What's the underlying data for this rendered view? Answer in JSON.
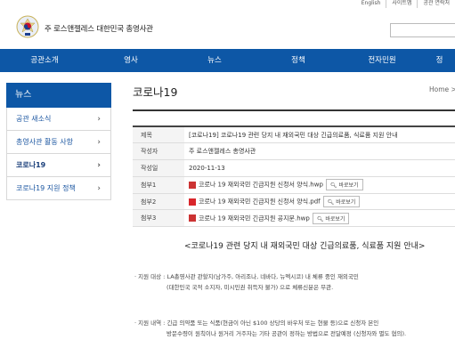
{
  "util": {
    "links": [
      "English",
      "사이트맵",
      "공관 연락처"
    ]
  },
  "header": {
    "site_title": "주 로스앤젤레스 대한민국 총영사관",
    "search_placeholder": ""
  },
  "gnb": {
    "items": [
      "공관소개",
      "영사",
      "뉴스",
      "정책",
      "전자민원",
      "정"
    ]
  },
  "sidebar": {
    "title": "뉴스",
    "items": [
      {
        "label": "공관 새소식",
        "arrow": "›"
      },
      {
        "label": "총영사관 활동 사항",
        "arrow": "›"
      },
      {
        "label": "코로나19",
        "arrow": "›"
      },
      {
        "label": "코로나19 지원 정책",
        "arrow": "›"
      }
    ]
  },
  "content": {
    "page_title": "코로나19",
    "breadcrumb": "Home >",
    "table": {
      "rows": [
        {
          "label": "제목",
          "value": "[코로나19] 코로나19 관련 당지 내 재외국민 대상 긴급의료품, 식료품 지원 안내"
        },
        {
          "label": "작성자",
          "value": "주 로스앤젤레스 총영사관"
        },
        {
          "label": "작성일",
          "value": "2020-11-13"
        },
        {
          "label": "첨부1",
          "file": "코로나 19 재외국민 긴급지원 신청서 양식.hwp",
          "btn": "바로보기"
        },
        {
          "label": "첨부2",
          "file": "코로나 19 재외국민 긴급지원 신청서 양식.pdf",
          "btn": "바로보기"
        },
        {
          "label": "첨부3",
          "file": "코로나 19 재외국민 긴급지원 공지문.hwp",
          "btn": "바로보기"
        }
      ]
    },
    "notice_heading": "<코로나19 관련 당지 내 재외국민 대상 긴급의료품, 식료품 지원 안내>",
    "body": {
      "line1": "· 지원 대상 : LA총영사관 관할지(남가주, 아리조나, 네바다, 뉴멕시코) 내 체류 중인 재외국민",
      "line2": "(대한민국 국적 소지자, 미시민권 취득자 불가) 으로 체류신분은 무관.",
      "line3": "· 지원 내역 : 긴급 의약품 또는 식품(현금이 아닌 $100 상당의 바우처 또는 현물 등)으로 신청자 본인",
      "line4": "방문수령이 원칙이나 원거리 거주자는 기타 공관이 정하는 방법으로 전달예정 (신청자와 별도 협의)."
    }
  },
  "colors": {
    "primary_blue": "#0d57a6"
  }
}
